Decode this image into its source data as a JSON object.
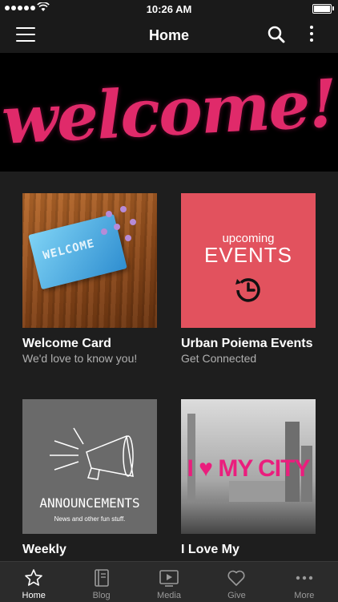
{
  "status_bar": {
    "time": "10:26 AM"
  },
  "header": {
    "title": "Home"
  },
  "banner": {
    "text": "welcome!",
    "accent": "#e02a6a"
  },
  "cards": [
    {
      "title": "Welcome Card",
      "subtitle": "We'd love to know you!",
      "thumb_text": "WELCOME"
    },
    {
      "title": "Urban Poiema Events",
      "subtitle": "Get Connected",
      "thumb_line1": "upcoming",
      "thumb_line2": "EVENTS"
    },
    {
      "title": "Weekly",
      "thumb_title": "ANNOUNCEMENTS",
      "thumb_sub": "News and other fun stuff."
    },
    {
      "title": "I Love My",
      "thumb_text": "I ♥ MY CITY",
      "accent": "#ea1e7d"
    }
  ],
  "tabs": [
    {
      "label": "Home",
      "icon": "star-icon",
      "active": true
    },
    {
      "label": "Blog",
      "icon": "book-icon"
    },
    {
      "label": "Media",
      "icon": "play-icon"
    },
    {
      "label": "Give",
      "icon": "heart-icon"
    },
    {
      "label": "More",
      "icon": "more-icon"
    }
  ]
}
